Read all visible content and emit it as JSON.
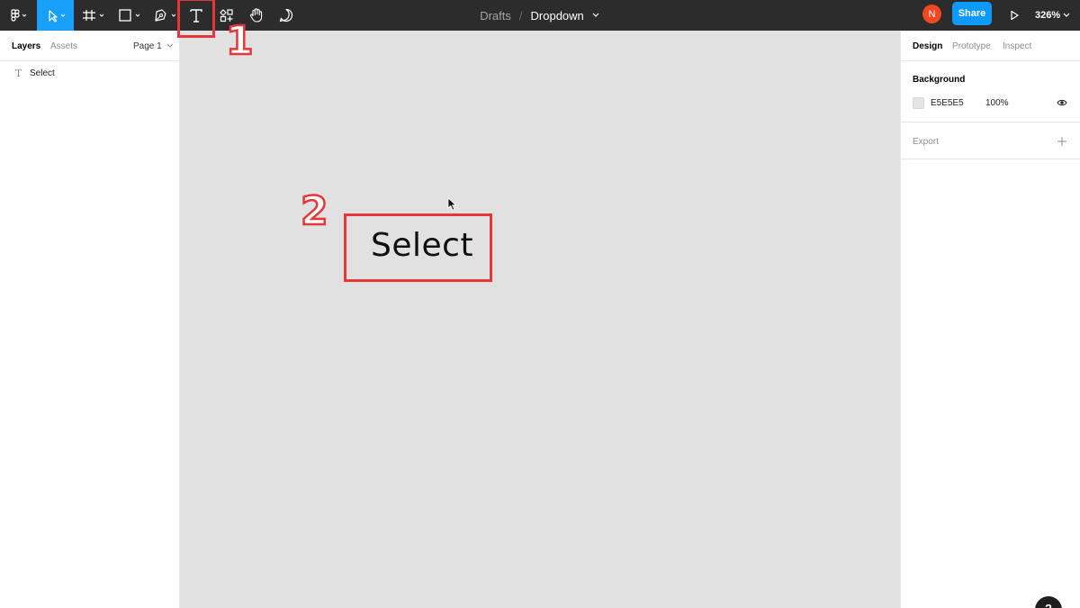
{
  "toolbar": {
    "icons": [
      "figma-menu-icon",
      "move-tool-icon",
      "frame-tool-icon",
      "shape-tool-icon",
      "pen-tool-icon",
      "text-tool-icon",
      "resources-icon",
      "hand-tool-icon",
      "comment-icon"
    ],
    "breadcrumb": {
      "folder": "Drafts",
      "separator": "/",
      "file": "Dropdown"
    },
    "avatar_initial": "N",
    "share_label": "Share",
    "zoom": "326%"
  },
  "left_panel": {
    "tabs": [
      "Layers",
      "Assets"
    ],
    "page_selector": "Page 1",
    "layers": [
      {
        "icon": "T",
        "name": "Select"
      }
    ]
  },
  "canvas": {
    "text_content": "Select",
    "background": "#e5e5e5"
  },
  "right_panel": {
    "tabs": [
      "Design",
      "Prototype",
      "Inspect"
    ],
    "background": {
      "title": "Background",
      "hex": "E5E5E5",
      "opacity": "100%"
    },
    "export_title": "Export"
  },
  "annotations": {
    "step1": "1",
    "step2": "2",
    "color": "#e5373a"
  },
  "colors": {
    "toolbar": "#2c2c2c",
    "active_tool": "#18a0fb",
    "share": "#0d99ff",
    "avatar": "#f24822"
  },
  "help_label": "?"
}
